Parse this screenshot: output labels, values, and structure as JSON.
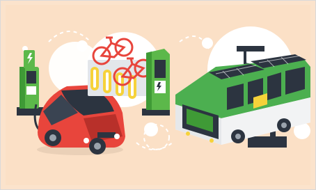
{
  "illustration": {
    "subject": "electric-mobility",
    "palette": {
      "background": "#fbe0c6",
      "blob": "#ffffff",
      "car_red": "#e8453c",
      "car_dark": "#b8302a",
      "charger_green": "#5cb84a",
      "bus_green": "#4caf50",
      "bike_yellow": "#f6d23a",
      "dark": "#2c3440",
      "gray": "#d9dce0"
    },
    "icons": [
      "charging-station-icon",
      "electric-car-icon",
      "bicycle-rack-icon",
      "bicycle-icon",
      "electric-bus-icon",
      "solar-panel-icon",
      "charging-pole-icon"
    ],
    "bus_sign_text": ""
  }
}
